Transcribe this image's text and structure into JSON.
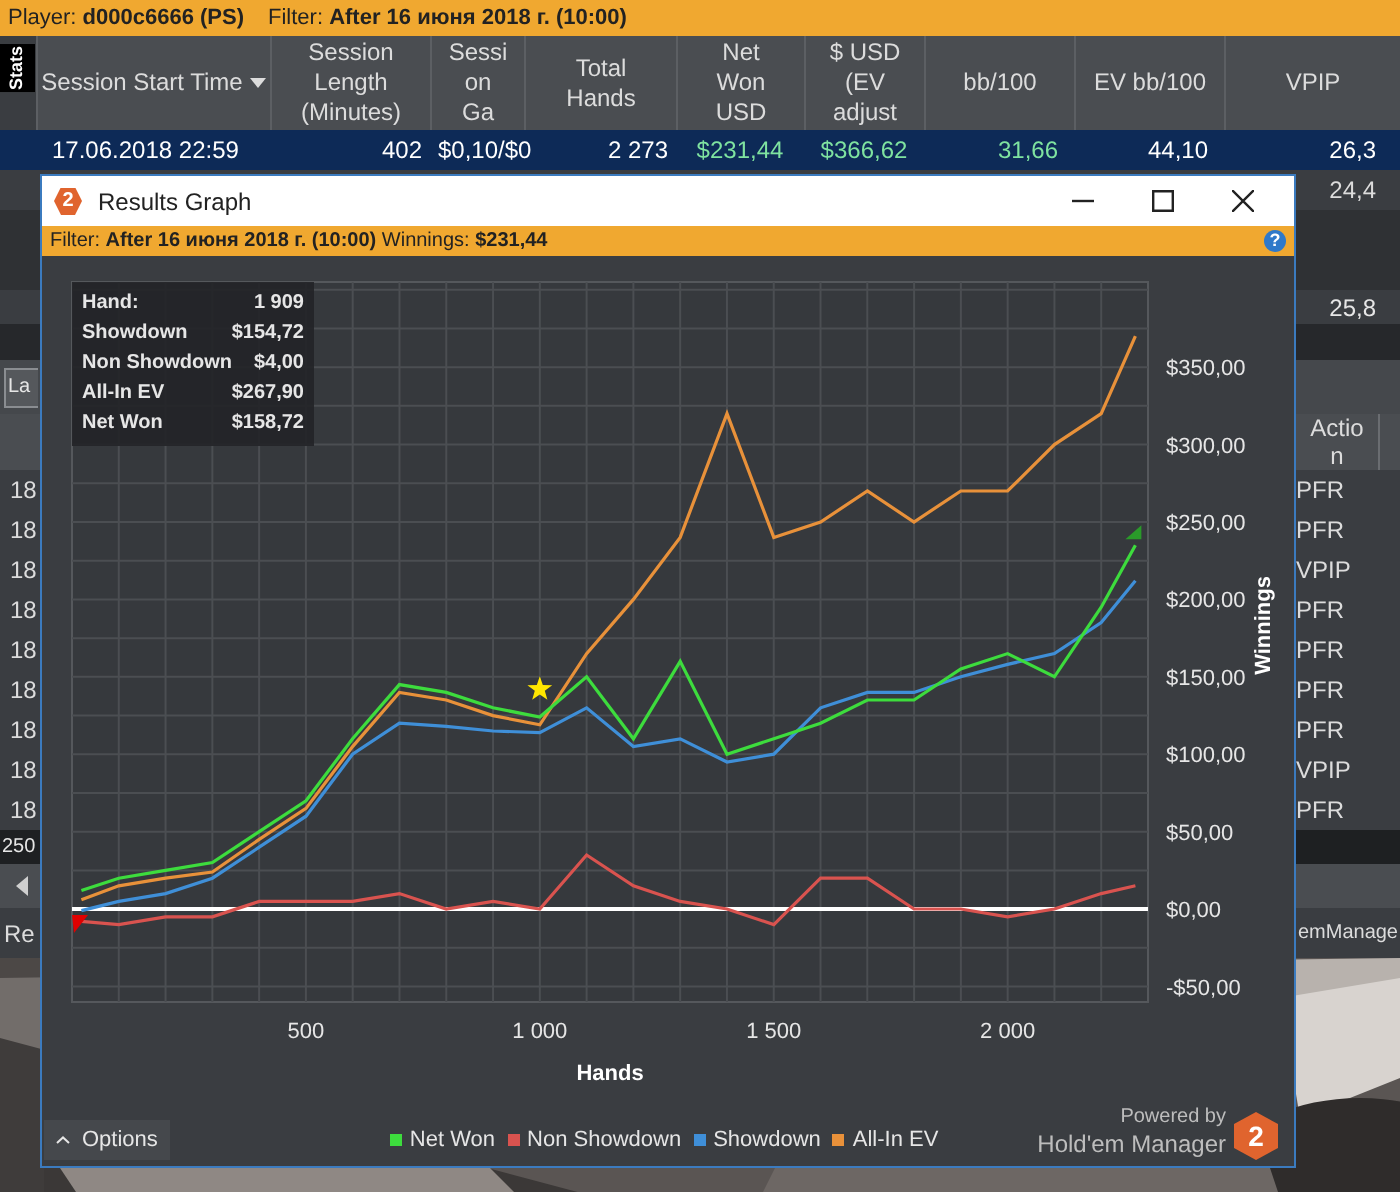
{
  "top_bar": {
    "player": "Player: **d000c6666 (PS)**",
    "filter": "Filter: **After 16 июня 2018 г. (10:00)**"
  },
  "side_tab": "Stats",
  "sessions_table": {
    "columns": [
      {
        "label": "Session Start Time",
        "sorted": true
      },
      {
        "label": "Session\nLength\n(Minutes)",
        "sorted": false
      },
      {
        "label": "Sessi\non\nGa",
        "sorted": false
      },
      {
        "label": "Total\nHands",
        "sorted": false
      },
      {
        "label": "Net\nWon\nUSD",
        "sorted": false
      },
      {
        "label": "$ USD\n(EV\nadjust",
        "sorted": false
      },
      {
        "label": "bb/100",
        "sorted": false
      },
      {
        "label": "EV bb/100",
        "sorted": false
      },
      {
        "label": "VPIP",
        "sorted": false
      }
    ],
    "rows": [
      {
        "selected": true,
        "cells": [
          {
            "text": "17.06.2018 22:59",
            "positive": false
          },
          {
            "text": "402",
            "positive": false
          },
          {
            "text": "$0,10/$0",
            "positive": false
          },
          {
            "text": "2 273",
            "positive": false
          },
          {
            "text": "$231,44",
            "positive": true
          },
          {
            "text": "$366,62",
            "positive": true
          },
          {
            "text": "31,66",
            "positive": true
          },
          {
            "text": "44,10",
            "positive": false
          },
          {
            "text": "26,3",
            "positive": false
          }
        ]
      },
      {
        "selected": false,
        "cells": [
          {
            "text": "24,4",
            "positive": false
          }
        ]
      }
    ],
    "total_row": "25,8"
  },
  "hands_panel": {
    "filter_field": "La",
    "action_header": "Actio\nn",
    "rows": [
      {
        "date": "18",
        "action": "PFR"
      },
      {
        "date": "18",
        "action": "PFR"
      },
      {
        "date": "18",
        "action": "VPIP"
      },
      {
        "date": "18",
        "action": "PFR"
      },
      {
        "date": "18",
        "action": "PFR"
      },
      {
        "date": "18",
        "action": "PFR"
      },
      {
        "date": "18",
        "action": "PFR"
      },
      {
        "date": "18",
        "action": "VPIP"
      },
      {
        "date": "18",
        "action": "PFR"
      }
    ],
    "footer": "250",
    "status_left": "Re",
    "status_right": "emManage"
  },
  "graph_window": {
    "logo": "2",
    "title": "Results Graph",
    "filter": "Filter: **After 16 июня 2018 г. (10:00)** Winnings: **$231,44**",
    "help": "?",
    "tooltip": [
      {
        "label": "Hand:",
        "value": "1 909"
      },
      {
        "label": "Showdown",
        "value": "$154,72"
      },
      {
        "label": "Non Showdown",
        "value": "$4,00"
      },
      {
        "label": "All-In EV",
        "value": "$267,90"
      },
      {
        "label": "Net Won",
        "value": "$158,72"
      }
    ],
    "chart_data": {
      "type": "line",
      "xlabel": "Hands",
      "ylabel": "Winnings",
      "x": [
        20,
        100,
        200,
        300,
        400,
        500,
        600,
        700,
        800,
        900,
        1000,
        1100,
        1200,
        1300,
        1400,
        1500,
        1600,
        1700,
        1800,
        1900,
        2000,
        2100,
        2200,
        2273
      ],
      "series": [
        {
          "name": "Net Won",
          "color": "#3ddc3d",
          "values": [
            12,
            20,
            25,
            30,
            50,
            70,
            110,
            145,
            140,
            130,
            124,
            150,
            110,
            160,
            100,
            110,
            120,
            135,
            135,
            155,
            165,
            150,
            195,
            235
          ]
        },
        {
          "name": "Non Showdown",
          "color": "#d9534f",
          "values": [
            -8,
            -10,
            -5,
            -5,
            5,
            5,
            5,
            10,
            0,
            5,
            0,
            35,
            15,
            5,
            0,
            -10,
            20,
            20,
            0,
            0,
            -5,
            0,
            10,
            15
          ]
        },
        {
          "name": "Showdown",
          "color": "#3f8fd8",
          "values": [
            -1,
            5,
            10,
            20,
            40,
            60,
            100,
            120,
            118,
            115,
            114,
            130,
            105,
            110,
            95,
            100,
            130,
            140,
            140,
            150,
            158,
            165,
            185,
            212
          ]
        },
        {
          "name": "All-In EV",
          "color": "#e8913a",
          "values": [
            6,
            15,
            20,
            24,
            45,
            65,
            105,
            140,
            135,
            125,
            119,
            165,
            200,
            240,
            320,
            240,
            250,
            270,
            250,
            270,
            270,
            300,
            320,
            370
          ]
        }
      ],
      "grid": true,
      "xlim": [
        0,
        2300
      ],
      "ylim": [
        -60,
        405
      ],
      "xticks": [
        {
          "value": 500,
          "label": "500"
        },
        {
          "value": 1000,
          "label": "1 000"
        },
        {
          "value": 1500,
          "label": "1 500"
        },
        {
          "value": 2000,
          "label": "2 000"
        }
      ],
      "yticks": [
        {
          "value": -50,
          "label": "-$50,00"
        },
        {
          "value": 0,
          "label": "$0,00"
        },
        {
          "value": 50,
          "label": "$50,00"
        },
        {
          "value": 100,
          "label": "$100,00"
        },
        {
          "value": 150,
          "label": "$150,00"
        },
        {
          "value": 200,
          "label": "$200,00"
        },
        {
          "value": 250,
          "label": "$250,00"
        },
        {
          "value": 300,
          "label": "$300,00"
        },
        {
          "value": 350,
          "label": "$350,00"
        }
      ]
    },
    "options_button": "Options",
    "powered_by": "Powered by",
    "brand": "Hold'em Manager",
    "brand_logo": "2"
  }
}
